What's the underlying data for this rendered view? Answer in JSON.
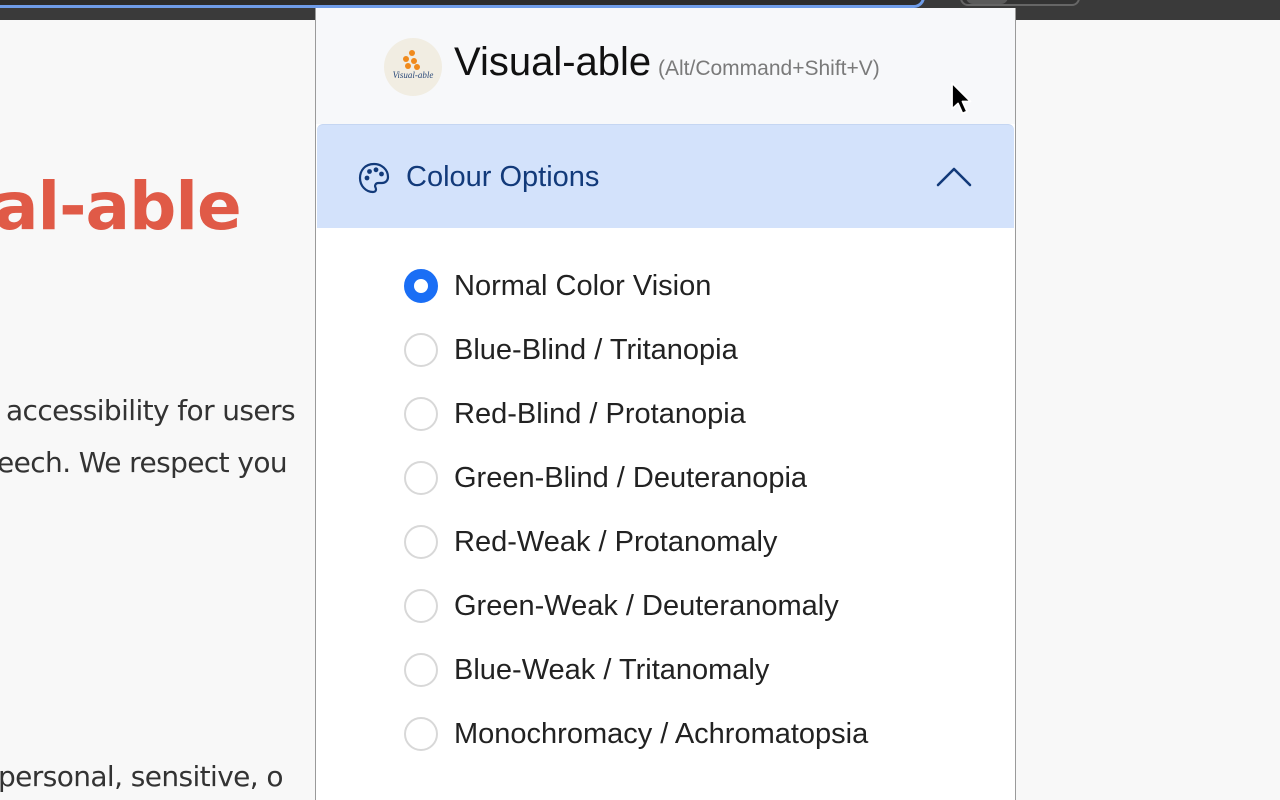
{
  "background_page": {
    "heading_fragment": "al-able",
    "line1": "accessibility for users",
    "line2": "eech. We respect you",
    "line3": "personal, sensitive, o"
  },
  "popup": {
    "logo_text": "Visual-able",
    "title": "Visual-able",
    "shortcut": "(Alt/Command+Shift+V)",
    "section": {
      "title": "Colour Options",
      "icon": "palette-icon",
      "expanded": true,
      "toggle_icon": "chevron-up-icon"
    },
    "options": [
      {
        "label": "Normal Color Vision",
        "checked": true
      },
      {
        "label": "Blue-Blind / Tritanopia",
        "checked": false
      },
      {
        "label": "Red-Blind / Protanopia",
        "checked": false
      },
      {
        "label": "Green-Blind / Deuteranopia",
        "checked": false
      },
      {
        "label": "Red-Weak / Protanomaly",
        "checked": false
      },
      {
        "label": "Green-Weak / Deuteranomaly",
        "checked": false
      },
      {
        "label": "Blue-Weak / Tritanomaly",
        "checked": false
      },
      {
        "label": "Monochromacy / Achromatopsia",
        "checked": false
      }
    ]
  },
  "colors": {
    "accent": "#1a6ef5",
    "section_bg": "#d3e2fb",
    "section_text": "#123a7a",
    "heading_red": "#e05a47"
  }
}
